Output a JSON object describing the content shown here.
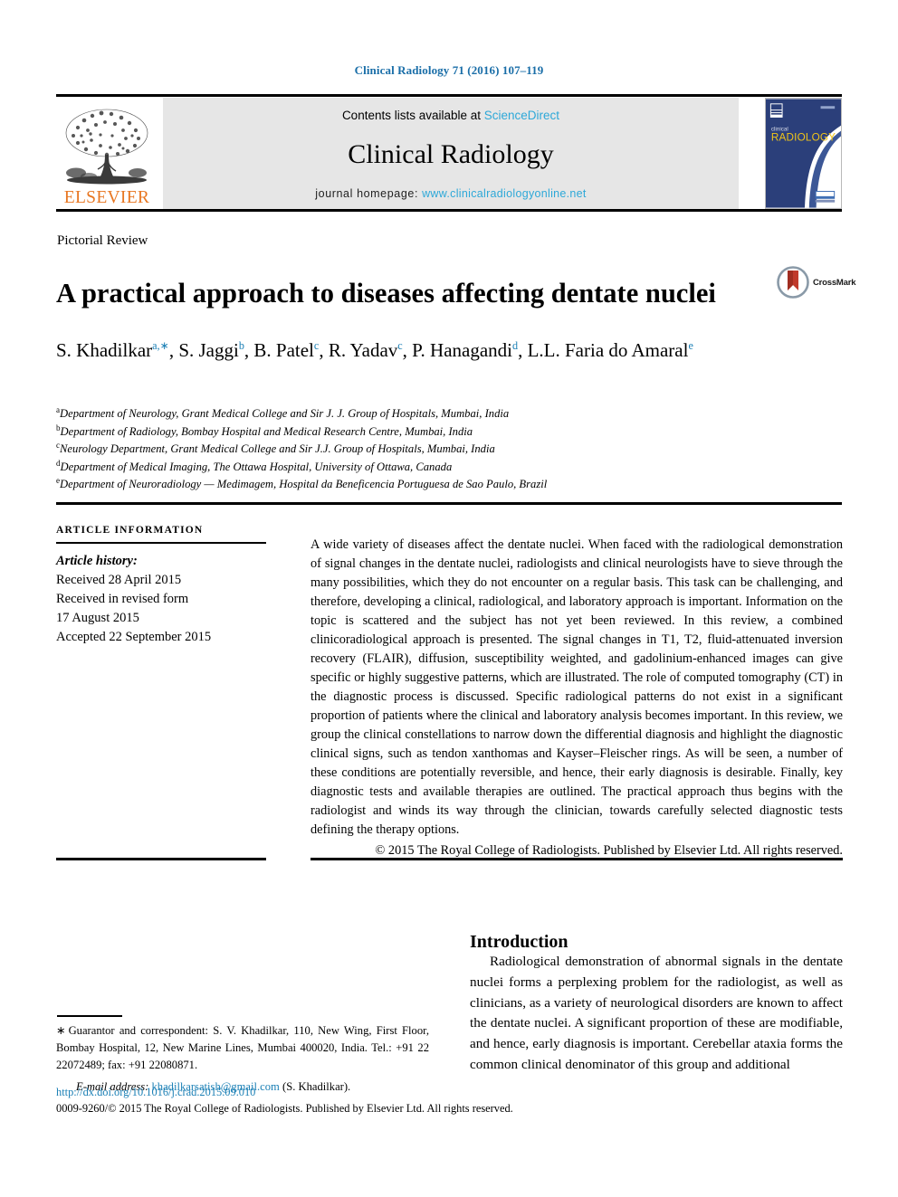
{
  "running_head": "Clinical Radiology 71 (2016) 107–119",
  "masthead": {
    "contents_prefix": "Contents lists available at ",
    "sciencedirect": "ScienceDirect",
    "journal_name": "Clinical Radiology",
    "homepage_prefix": "journal homepage: ",
    "homepage_url": "www.clinicalradiologyonline.net",
    "publisher_name": "ELSEVIER",
    "cover_title_small": "clinical",
    "cover_title_large": "RADIOLOGY"
  },
  "article": {
    "type": "Pictorial Review",
    "title": "A practical approach to diseases affecting dentate nuclei",
    "crossmark_label": "CrossMark",
    "authors": [
      {
        "name": "S. Khadilkar",
        "sup": "a,∗",
        "sep": ", "
      },
      {
        "name": "S. Jaggi",
        "sup": "b",
        "sep": ", "
      },
      {
        "name": "B. Patel",
        "sup": "c",
        "sep": ", "
      },
      {
        "name": "R. Yadav",
        "sup": "c",
        "sep": ", "
      },
      {
        "name": "P. Hanagandi",
        "sup": "d",
        "sep": ", "
      },
      {
        "name": "L.L. Faria do Amaral",
        "sup": "e",
        "sep": ""
      }
    ],
    "affiliations": [
      {
        "mark": "a",
        "text": "Department of Neurology, Grant Medical College and Sir J. J. Group of Hospitals, Mumbai, India"
      },
      {
        "mark": "b",
        "text": "Department of Radiology, Bombay Hospital and Medical Research Centre, Mumbai, India"
      },
      {
        "mark": "c",
        "text": "Neurology Department, Grant Medical College and Sir J.J. Group of Hospitals, Mumbai, India"
      },
      {
        "mark": "d",
        "text": "Department of Medical Imaging, The Ottawa Hospital, University of Ottawa, Canada"
      },
      {
        "mark": "e",
        "text": "Department of Neuroradiology — Medimagem, Hospital da Beneficencia Portuguesa de Sao Paulo, Brazil"
      }
    ]
  },
  "article_information": {
    "heading": "ARTICLE INFORMATION",
    "history_label": "Article history:",
    "history_lines": [
      "Received 28 April 2015",
      "Received in revised form",
      "17 August 2015",
      "Accepted 22 September 2015"
    ]
  },
  "abstract": {
    "body": "A wide variety of diseases affect the dentate nuclei. When faced with the radiological demonstration of signal changes in the dentate nuclei, radiologists and clinical neurologists have to sieve through the many possibilities, which they do not encounter on a regular basis. This task can be challenging, and therefore, developing a clinical, radiological, and laboratory approach is important. Information on the topic is scattered and the subject has not yet been reviewed. In this review, a combined clinicoradiological approach is presented. The signal changes in T1, T2, fluid-attenuated inversion recovery (FLAIR), diffusion, susceptibility weighted, and gadolinium-enhanced images can give specific or highly suggestive patterns, which are illustrated. The role of computed tomography (CT) in the diagnostic process is discussed. Specific radiological patterns do not exist in a significant proportion of patients where the clinical and laboratory analysis becomes important. In this review, we group the clinical constellations to narrow down the differential diagnosis and highlight the diagnostic clinical signs, such as tendon xanthomas and Kayser–Fleischer rings. As will be seen, a number of these conditions are potentially reversible, and hence, their early diagnosis is desirable. Finally, key diagnostic tests and available therapies are outlined. The practical approach thus begins with the radiologist and winds its way through the clinician, towards carefully selected diagnostic tests defining the therapy options.",
    "copyright": "© 2015 The Royal College of Radiologists. Published by Elsevier Ltd. All rights reserved."
  },
  "introduction": {
    "heading": "Introduction",
    "body": "Radiological demonstration of abnormal signals in the dentate nuclei forms a perplexing problem for the radiologist, as well as clinicians, as a variety of neurological disorders are known to affect the dentate nuclei. A significant proportion of these are modifiable, and hence, early diagnosis is important. Cerebellar ataxia forms the common clinical denominator of this group and additional"
  },
  "footnote": {
    "star": "∗",
    "correspondence": "Guarantor and correspondent: S. V. Khadilkar, 110, New Wing, First Floor, Bombay Hospital, 12, New Marine Lines, Mumbai 400020, India. Tel.: +91 22 22072489; fax: +91 22080871.",
    "email_label": "E-mail address:",
    "email": "khadilkarsatish@gmail.com",
    "email_owner": "(S. Khadilkar)."
  },
  "footer": {
    "doi": "http://dx.doi.org/10.1016/j.crad.2015.09.010",
    "copyright": "0009-9260/© 2015 The Royal College of Radiologists. Published by Elsevier Ltd. All rights reserved."
  },
  "colors": {
    "link_blue": "#1a7fb5",
    "sciencedirect_blue": "#2da8d8",
    "elsevier_orange": "#e87722",
    "masthead_grey": "#e6e6e6",
    "cover_navy": "#2b3f7a"
  }
}
